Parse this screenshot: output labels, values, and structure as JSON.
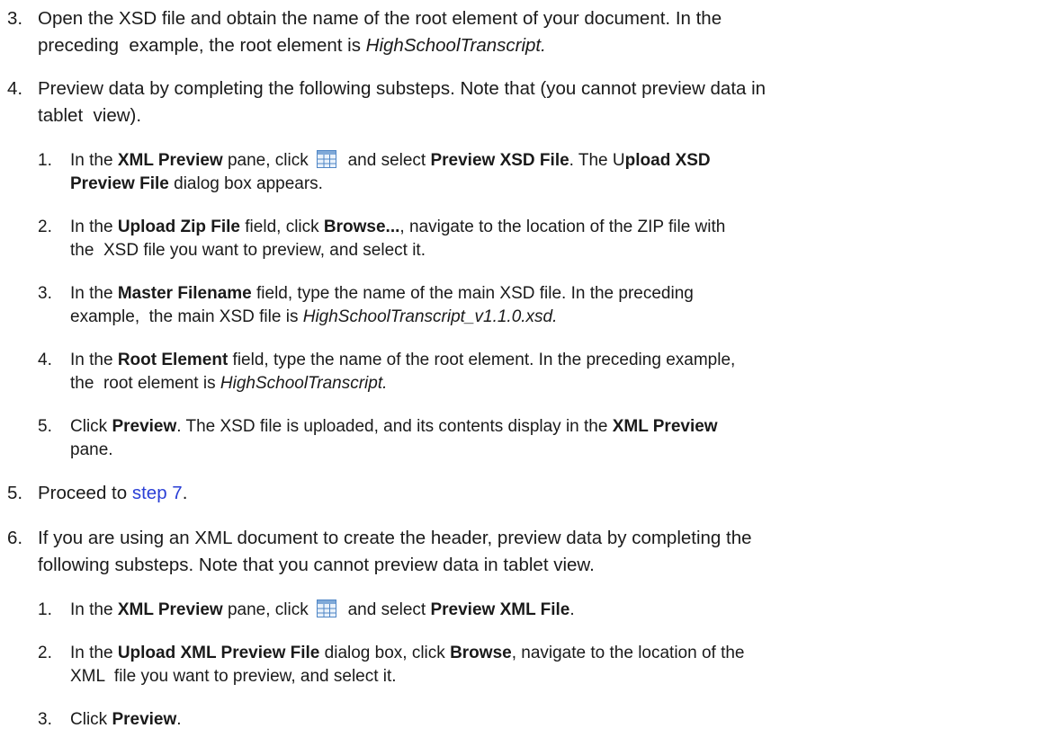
{
  "steps": {
    "s3": {
      "num": "3.",
      "l1_a": "Open the XSD file and obtain the name of the root element of your document. In the",
      "l2_a": "preceding  example, the root element is ",
      "l2_b": "HighSchoolTranscript."
    },
    "s4": {
      "num": "4.",
      "l1": "Preview data by completing the following substeps. Note that (you cannot preview data in",
      "l2": "tablet  view).",
      "sub": {
        "a": {
          "num": "1.",
          "t1": "In the ",
          "t2": "XML Preview",
          "t3": " pane, click ",
          "t4": "  and select ",
          "t5": "Preview XSD File",
          "t6": ". The U",
          "t7": "pload XSD",
          "t8": "Preview File",
          "t9": " dialog box appears."
        },
        "b": {
          "num": "2.",
          "t1": "In the ",
          "t2": "Upload Zip File",
          "t3": " field, click ",
          "t4": "Browse...",
          "t5": ", navigate to the location of the ZIP file with",
          "t6": "the  XSD file you want to preview, and select it."
        },
        "c": {
          "num": "3.",
          "t1": "In the ",
          "t2": "Master Filename",
          "t3": " field, type the name of the main XSD file. In the preceding",
          "t4": "example,  the main XSD file is ",
          "t5": "HighSchoolTranscript_v1.1.0.xsd."
        },
        "d": {
          "num": "4.",
          "t1": "In the ",
          "t2": "Root Element",
          "t3": " field, type the name of the root element. In the preceding example,",
          "t4": "the  root element is ",
          "t5": "HighSchoolTranscript."
        },
        "e": {
          "num": "5.",
          "t1": "Click ",
          "t2": "Preview",
          "t3": ". The XSD file is uploaded, and its contents display in the ",
          "t4": "XML Preview",
          "t5": "pane."
        }
      }
    },
    "s5": {
      "num": "5.",
      "t1": "Proceed to ",
      "link": "step 7",
      "t2": "."
    },
    "s6": {
      "num": "6.",
      "l1": "If you are using an XML document to create the header, preview data by completing the",
      "l2": "following substeps. Note that you cannot preview data in tablet view.",
      "sub": {
        "a": {
          "num": "1.",
          "t1": "In the ",
          "t2": "XML Preview",
          "t3": " pane, click ",
          "t4": "  and select ",
          "t5": "Preview XML File",
          "t6": "."
        },
        "b": {
          "num": "2.",
          "t1": "In the ",
          "t2": "Upload XML Preview File",
          "t3": " dialog box, click ",
          "t4": "Browse",
          "t5": ", navigate to the location of the",
          "t6": "XML  file you want to preview, and select it."
        },
        "c": {
          "num": "3.",
          "t1": "Click ",
          "t2": "Preview",
          "t3": "."
        }
      }
    }
  },
  "icons": {
    "preview_menu": "table-grid-icon",
    "color": "#4f86c6"
  }
}
